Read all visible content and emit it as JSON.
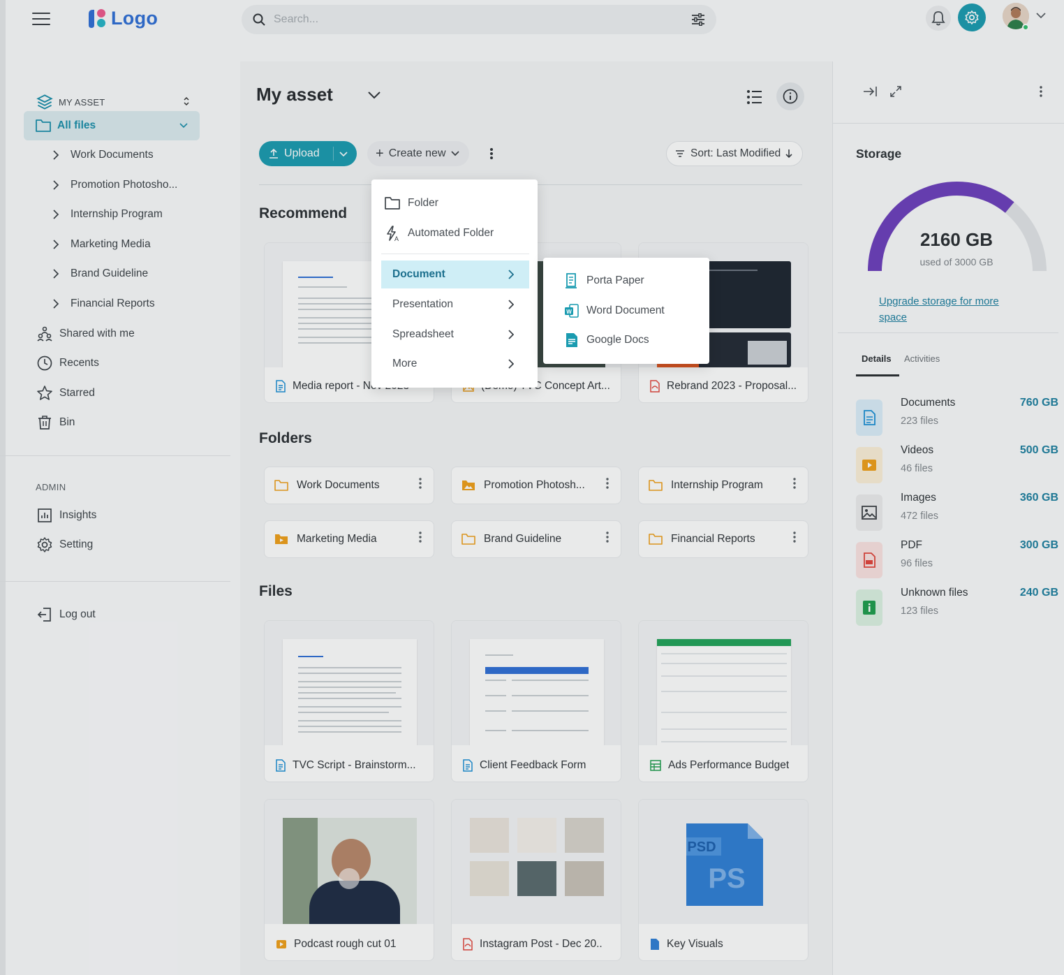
{
  "header": {
    "logo_text": "Logo",
    "search_placeholder": "Search...",
    "brand_color": "#1a9bb0"
  },
  "sidebar": {
    "asset_selector": "MY ASSET",
    "all_files": "All files",
    "sub_items": [
      {
        "label": "Work Documents"
      },
      {
        "label": "Promotion Photosho..."
      },
      {
        "label": "Internship Program"
      },
      {
        "label": "Marketing Media"
      },
      {
        "label": "Brand Guideline"
      },
      {
        "label": "Financial Reports"
      }
    ],
    "main_items": [
      {
        "label": "Shared with me",
        "icon": "shared-users-icon"
      },
      {
        "label": "Recents",
        "icon": "clock-icon"
      },
      {
        "label": "Starred",
        "icon": "star-icon"
      },
      {
        "label": "Bin",
        "icon": "trash-icon"
      }
    ],
    "admin_heading": "ADMIN",
    "admin_items": [
      {
        "label": "Insights",
        "icon": "chart-icon"
      },
      {
        "label": "Setting",
        "icon": "gear-icon"
      }
    ],
    "logout": "Log out"
  },
  "main": {
    "title": "My asset",
    "upload_label": "Upload",
    "create_label": "Create new",
    "sort_label": "Sort: Last Modified",
    "recommend_title": "Recommend",
    "recommend": [
      {
        "label": "Media report - Nov 2023",
        "icon": "doc-icon"
      },
      {
        "label": "(Demo) TVC Concept Art...",
        "icon": "image-icon"
      },
      {
        "label": "Rebrand 2023 - Proposal...",
        "icon": "pdf-icon"
      }
    ],
    "folders_title": "Folders",
    "folders": [
      {
        "label": "Work Documents",
        "style": "outline"
      },
      {
        "label": "Promotion Photosh...",
        "style": "filled-image"
      },
      {
        "label": "Internship Program",
        "style": "outline"
      },
      {
        "label": "Marketing Media",
        "style": "filled-video"
      },
      {
        "label": "Brand Guideline",
        "style": "outline"
      },
      {
        "label": "Financial Reports",
        "style": "outline"
      }
    ],
    "files_title": "Files",
    "files": [
      {
        "label": "TVC Script - Brainstorm...",
        "icon": "doc-icon"
      },
      {
        "label": "Client Feedback Form",
        "icon": "doc-icon"
      },
      {
        "label": "Ads Performance Budget",
        "icon": "sheet-icon"
      },
      {
        "label": "Podcast rough cut 01",
        "icon": "video-icon"
      },
      {
        "label": "Instagram Post - Dec 20..",
        "icon": "pdf-icon"
      },
      {
        "label": "Key Visuals",
        "icon": "psd-icon"
      }
    ]
  },
  "create_menu": {
    "items": [
      {
        "label": "Folder"
      },
      {
        "label": "Automated Folder"
      }
    ],
    "submenus": [
      {
        "label": "Document",
        "active": true
      },
      {
        "label": "Presentation",
        "active": false
      },
      {
        "label": "Spreadsheet",
        "active": false
      },
      {
        "label": "More",
        "active": false
      }
    ],
    "document_options": [
      {
        "label": "Porta Paper"
      },
      {
        "label": "Word Document"
      },
      {
        "label": "Google Docs"
      }
    ]
  },
  "storage": {
    "title": "Storage",
    "used": "2160 GB",
    "used_caption": "used of 3000 GB",
    "used_fraction": 0.72,
    "gauge_color": "#6c3fbd",
    "upgrade_link": "Upgrade storage for more space",
    "tabs": [
      "Details",
      "Activities"
    ],
    "items": [
      {
        "name": "Documents",
        "count": "223 files",
        "size": "760 GB",
        "color": "#1a8fd6",
        "bg": "#dbeefa"
      },
      {
        "name": "Videos",
        "count": "46 files",
        "size": "500 GB",
        "color": "#f0a01a",
        "bg": "#fcf0d8"
      },
      {
        "name": "Images",
        "count": "472 files",
        "size": "360 GB",
        "color": "#3a3f44",
        "bg": "#ececee"
      },
      {
        "name": "PDF",
        "count": "96 files",
        "size": "300 GB",
        "color": "#e2453c",
        "bg": "#fbe3e1"
      },
      {
        "name": "Unknown files",
        "count": "123 files",
        "size": "240 GB",
        "color": "#1f9d4d",
        "bg": "#dcf2e3"
      }
    ]
  }
}
